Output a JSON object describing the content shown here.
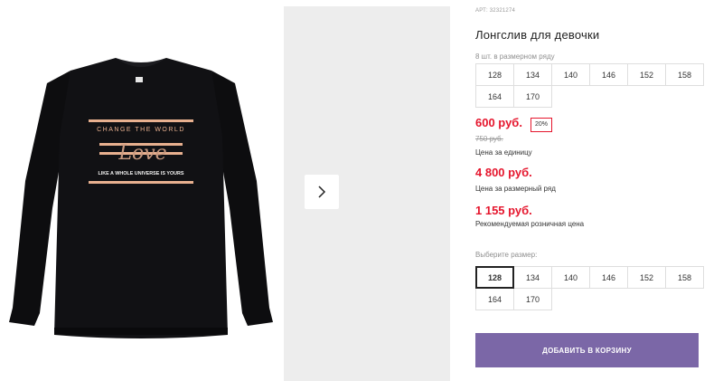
{
  "product": {
    "sku_label": "АРТ:",
    "sku": "32321274",
    "title": "Лонгслив для девочки",
    "image": {
      "print_line1": "CHANGE THE WORLD",
      "print_script": "Love",
      "print_line2": "LIKE A WHOLE UNIVERSE IS YOURS"
    }
  },
  "pack": {
    "label": "8 шт. в размерном ряду",
    "sizes": [
      "128",
      "134",
      "140",
      "146",
      "152",
      "158",
      "164",
      "170"
    ]
  },
  "pricing": {
    "unit_price": "600 руб.",
    "discount": "20%",
    "old_price": "750 руб.",
    "unit_label": "Цена за единицу",
    "set_price": "4 800 руб.",
    "set_label": "Цена за размерный ряд",
    "retail_price": "1 155 руб.",
    "retail_label": "Рекомендуемая розничная цена"
  },
  "size_select": {
    "label": "Выберите размер:",
    "selected": "128",
    "sizes": [
      "128",
      "134",
      "140",
      "146",
      "152",
      "158",
      "164",
      "170"
    ]
  },
  "cart": {
    "button_label": "ДОБАВИТЬ В КОРЗИНУ"
  },
  "colors": {
    "price": "#e5162d",
    "button": "#7b67a7",
    "print": "#e8b08f"
  },
  "icons": {
    "next": "chevron-right-icon"
  }
}
